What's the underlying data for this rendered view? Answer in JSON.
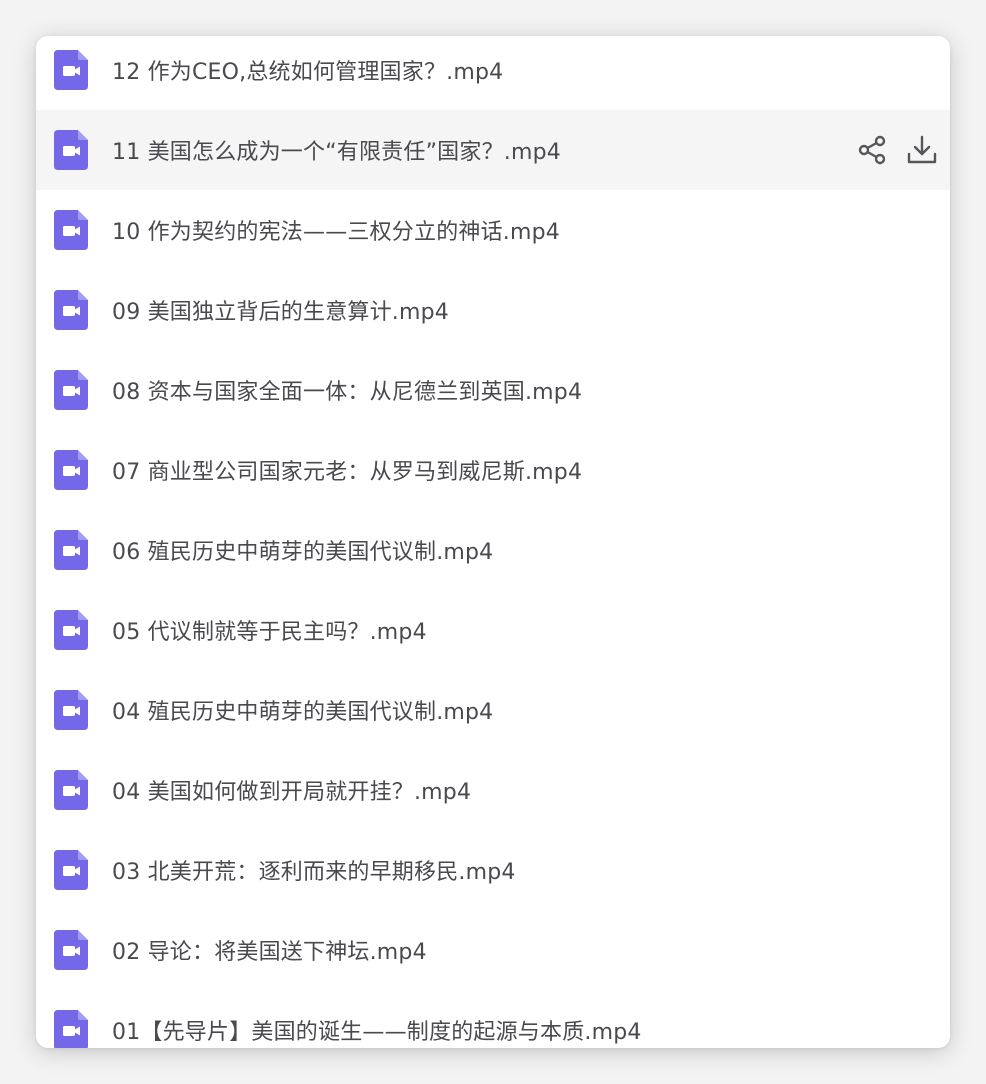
{
  "colors": {
    "video_icon": "#7568e8",
    "text": "#4a4a4e",
    "action_icon": "#55555a",
    "hover_row": "#f5f5f6"
  },
  "files": [
    {
      "name": "12 作为CEO,总统如何管理国家？.mp4",
      "icon": "video-file-icon"
    },
    {
      "name": "11 美国怎么成为一个“有限责任”国家？.mp4",
      "icon": "video-file-icon",
      "hovered": true,
      "actions": [
        "share-icon",
        "download-icon"
      ]
    },
    {
      "name": "10 作为契约的宪法——三权分立的神话.mp4",
      "icon": "video-file-icon"
    },
    {
      "name": "09 美国独立背后的生意算计.mp4",
      "icon": "video-file-icon"
    },
    {
      "name": "08 资本与国家全面一体：从尼德兰到英国.mp4",
      "icon": "video-file-icon"
    },
    {
      "name": "07 商业型公司国家元老：从罗马到威尼斯.mp4",
      "icon": "video-file-icon"
    },
    {
      "name": "06 殖民历史中萌芽的美国代议制.mp4",
      "icon": "video-file-icon"
    },
    {
      "name": "05 代议制就等于民主吗？.mp4",
      "icon": "video-file-icon"
    },
    {
      "name": "04 殖民历史中萌芽的美国代议制.mp4",
      "icon": "video-file-icon"
    },
    {
      "name": "04 美国如何做到开局就开挂？.mp4",
      "icon": "video-file-icon"
    },
    {
      "name": "03 北美开荒：逐利而来的早期移民.mp4",
      "icon": "video-file-icon"
    },
    {
      "name": "02 导论：将美国送下神坛.mp4",
      "icon": "video-file-icon"
    },
    {
      "name": "01【先导片】美国的诞生——制度的起源与本质.mp4",
      "icon": "video-file-icon"
    }
  ]
}
